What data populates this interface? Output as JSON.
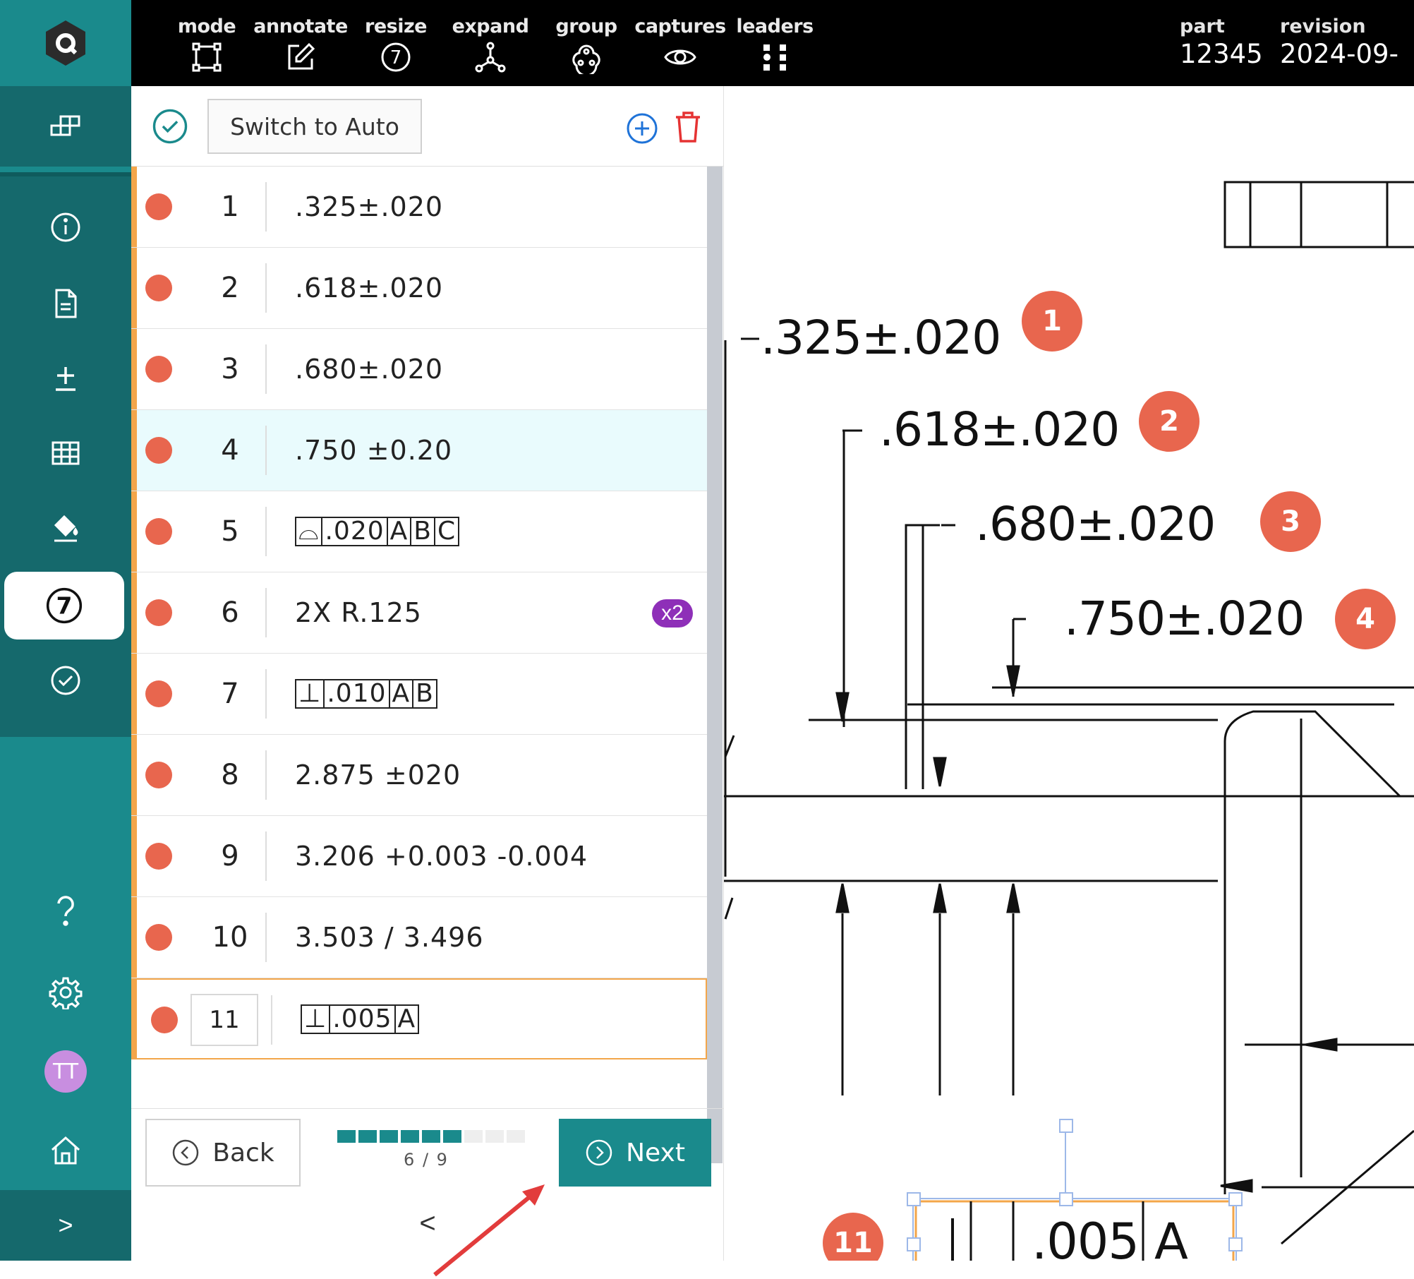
{
  "toolbar": {
    "items": [
      {
        "label": "mode",
        "icon": "bounding-box-icon"
      },
      {
        "label": "annotate",
        "icon": "edit-icon"
      },
      {
        "label": "resize",
        "icon": "number-seven-circle-icon",
        "glyph": "7"
      },
      {
        "label": "expand",
        "icon": "network-nodes-icon"
      },
      {
        "label": "group",
        "icon": "group-nodes-icon"
      },
      {
        "label": "captures",
        "icon": "eye-icon"
      },
      {
        "label": "leaders",
        "icon": "dot-grid-icon"
      }
    ],
    "part_label": "part",
    "part_value": "12345",
    "revision_label": "revision",
    "revision_value": "2024-09-"
  },
  "sidebar": {
    "avatar_initials": "TT",
    "active_glyph": "7",
    "expand_glyph": ">"
  },
  "panel": {
    "switch_label": "Switch to Auto",
    "rows": [
      {
        "num": "1",
        "text": ".325±.020"
      },
      {
        "num": "2",
        "text": ".618±.020"
      },
      {
        "num": "3",
        "text": ".680±.020"
      },
      {
        "num": "4",
        "text": ".750 ±0.20"
      },
      {
        "num": "5",
        "fcf": [
          "⌓",
          ".020",
          "A",
          "B",
          "C"
        ]
      },
      {
        "num": "6",
        "text": "2X R.125",
        "badge": "x2"
      },
      {
        "num": "7",
        "fcf": [
          "⊥",
          ".010",
          "A",
          "B"
        ]
      },
      {
        "num": "8",
        "text": "2.875 ±020"
      },
      {
        "num": "9",
        "text": "3.206 +0.003 -0.004"
      },
      {
        "num": "10",
        "text": "3.503 / 3.496"
      },
      {
        "num": "11",
        "fcf": [
          "⊥",
          ".005",
          "A"
        ]
      }
    ],
    "back_label": "Back",
    "next_label": "Next",
    "progress_text": "6 / 9",
    "progress_done": 6,
    "progress_total": 9,
    "collapse_glyph": "<"
  },
  "drawing": {
    "dimensions": [
      {
        "text": ".325±.020",
        "balloon": "1"
      },
      {
        "text": ".618±.020",
        "balloon": "2"
      },
      {
        "text": ".680±.020",
        "balloon": "3"
      },
      {
        "text": ".750±.020",
        "balloon": "4"
      }
    ],
    "fcf_cells": [
      ".005",
      "A"
    ],
    "balloon_11": "11"
  },
  "colors": {
    "teal": "#1a8a8c",
    "teal_dark": "#15696c",
    "accent_orange": "#f3a64a",
    "balloon_red": "#e8664e",
    "badge_purple": "#8e2fb8",
    "selected_row": "#e9fbfd"
  }
}
